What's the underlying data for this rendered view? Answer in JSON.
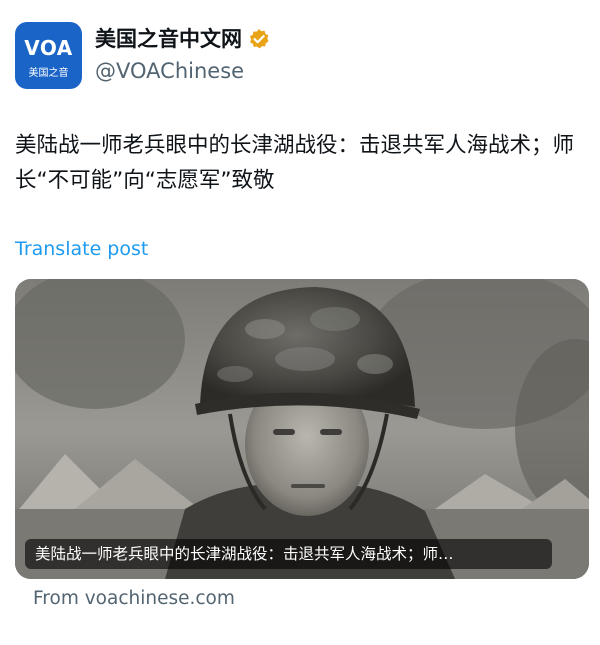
{
  "account": {
    "display_name": "美国之音中文网",
    "handle": "@VOAChinese",
    "avatar_text": "VOA",
    "avatar_subtext": "美国之音",
    "verified_icon": "verified-badge-icon",
    "verified_color": "#e8a317",
    "avatar_color": "#1a64c8"
  },
  "post": {
    "text": "美陆战一师老兵眼中的长津湖战役：击退共军人海战术；师长“不可能”向“志愿军”致敬",
    "translate_label": "Translate post"
  },
  "link_card": {
    "caption": "美陆战一师老兵眼中的长津湖战役：击退共军人海战术；师…",
    "source": "From voachinese.com"
  },
  "colors": {
    "link_blue": "#1d9bf0",
    "muted_gray": "#536471",
    "text_dark": "#0f1419"
  }
}
